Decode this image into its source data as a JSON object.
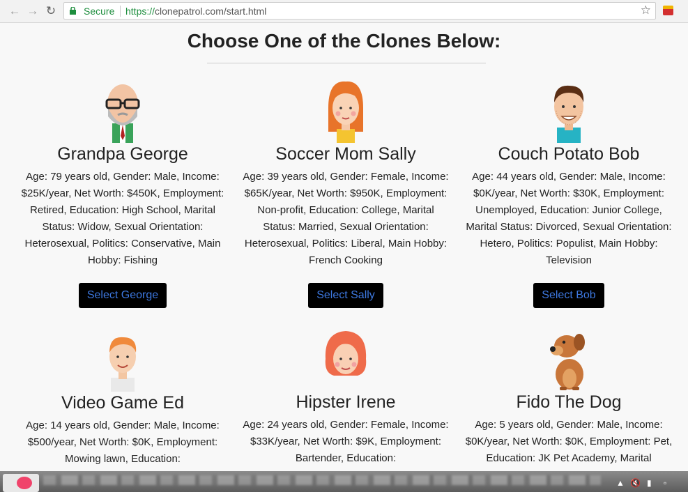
{
  "browser": {
    "secure_label": "Secure",
    "url_scheme": "https://",
    "url_rest": "clonepatrol.com/start.html",
    "back_icon": "arrow-left-icon",
    "forward_icon": "arrow-right-icon",
    "reload_icon": "reload-icon",
    "bookmark_icon": "star-icon"
  },
  "page": {
    "heading": "Choose One of the Clones Below:"
  },
  "clones": [
    {
      "name": "Grandpa George",
      "description": "Age: 79 years old, Gender: Male, Income: $25K/year, Net Worth: $450K, Employment: Retired, Education: High School, Marital Status: Widow, Sexual Orientation: Heterosexual, Politics: Conservative, Main Hobby: Fishing",
      "button": "Select George"
    },
    {
      "name": "Soccer Mom Sally",
      "description": "Age: 39 years old, Gender: Female, Income: $65K/year, Net Worth: $950K, Employment: Non-profit, Education: College, Marital Status: Married, Sexual Orientation: Heterosexual, Politics: Liberal, Main Hobby: French Cooking",
      "button": "Select Sally"
    },
    {
      "name": "Couch Potato Bob",
      "description": "Age: 44 years old, Gender: Male, Income: $0K/year, Net Worth: $30K, Employment: Unemployed, Education: Junior College, Marital Status: Divorced, Sexual Orientation: Hetero, Politics: Populist, Main Hobby: Television",
      "button": "Select Bob"
    },
    {
      "name": "Video Game Ed",
      "description": "Age: 14 years old, Gender: Male, Income: $500/year, Net Worth: $0K, Employment: Mowing lawn, Education:"
    },
    {
      "name": "Hipster Irene",
      "description": "Age: 24 years old, Gender: Female, Income: $33K/year, Net Worth: $9K, Employment: Bartender, Education:"
    },
    {
      "name": "Fido The Dog",
      "description": "Age: 5 years old, Gender: Male, Income: $0K/year, Net Worth: $0K, Employment: Pet, Education: JK Pet Academy, Marital"
    }
  ],
  "colors": {
    "button_bg": "#000000",
    "button_text": "#3d78e0",
    "secure_green": "#1e8e3e"
  }
}
